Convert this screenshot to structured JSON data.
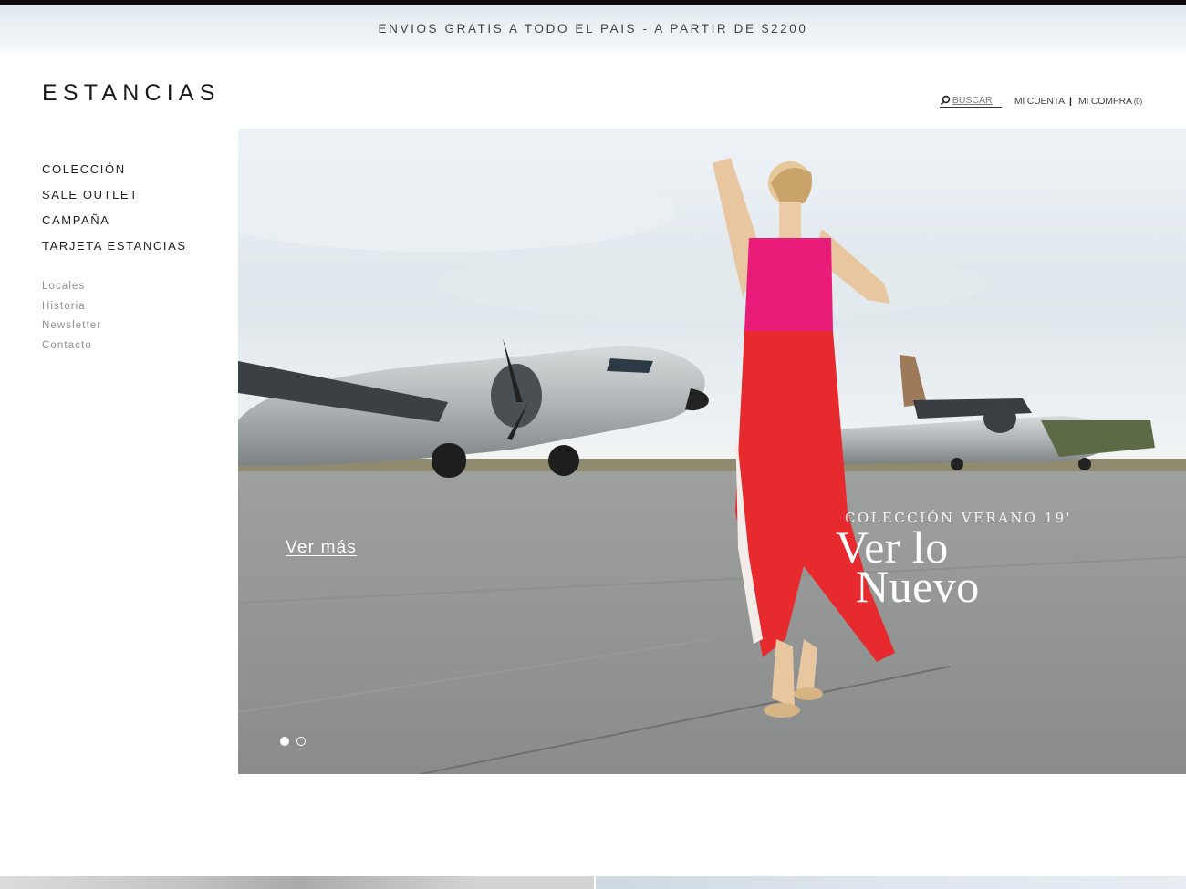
{
  "promo_bar": {
    "text": "ENVIOS GRATIS A TODO EL PAIS - A PARTIR DE $2200"
  },
  "brand": {
    "logo_text": "ESTANCIAS"
  },
  "header": {
    "search_label": "BUSCAR",
    "search_icon": "search-icon",
    "account_label": "MI CUENTA",
    "separator": "|",
    "cart_label": "MI COMPRA",
    "cart_count": "(0)"
  },
  "main_nav": {
    "items": [
      {
        "label": "COLECCIÓN"
      },
      {
        "label": "SALE OUTLET"
      },
      {
        "label": "CAMPAÑA"
      },
      {
        "label": "TARJETA ESTANCIAS"
      }
    ]
  },
  "secondary_nav": {
    "items": [
      {
        "label": "Locales"
      },
      {
        "label": "Historia"
      },
      {
        "label": "Newsletter"
      },
      {
        "label": "Contacto"
      }
    ]
  },
  "hero": {
    "cta_label": "Ver más",
    "eyebrow": "COLECCIÓN VERANO 19'",
    "headline_line1": "Ver lo",
    "headline_line2": "Nuevo",
    "slide_count": 2,
    "active_slide": 1
  }
}
